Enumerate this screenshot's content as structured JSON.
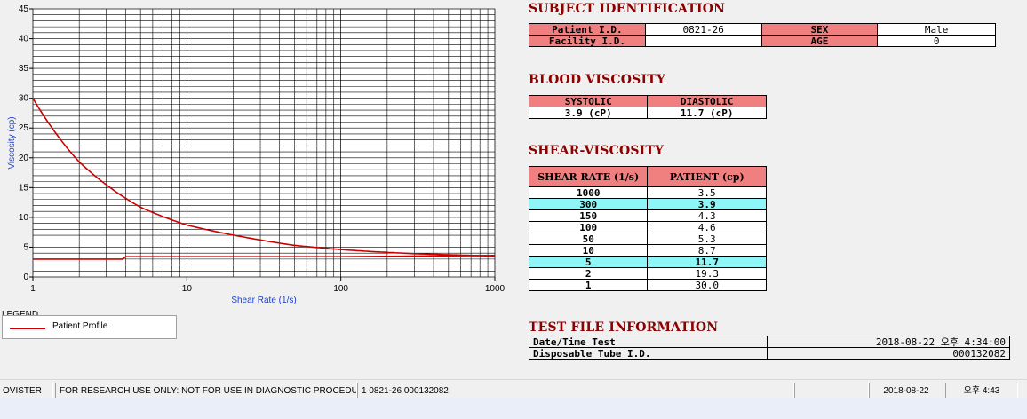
{
  "chart_data": {
    "type": "line",
    "xscale": "log",
    "xlim": [
      1,
      1000
    ],
    "ylim": [
      0,
      45
    ],
    "xticks": [
      "1",
      "10",
      "100",
      "1000"
    ],
    "yticks": [
      "0",
      "5",
      "10",
      "15",
      "20",
      "25",
      "30",
      "35",
      "40",
      "45"
    ],
    "xlabel": "Shear Rate (1/s)",
    "ylabel": "Viscosity (cp)",
    "grid": true,
    "series": [
      {
        "name": "Patient Profile",
        "color": "#cc0000",
        "x": [
          1,
          2,
          5,
          10,
          50,
          100,
          150,
          300,
          1000
        ],
        "y": [
          30.0,
          19.3,
          11.7,
          8.7,
          5.3,
          4.6,
          4.3,
          3.9,
          3.5
        ]
      },
      {
        "color": "#cc0000",
        "x": [
          1,
          3.8,
          4,
          10,
          100,
          1000
        ],
        "y": [
          3.0,
          3.0,
          3.4,
          3.4,
          3.4,
          3.6
        ]
      }
    ]
  },
  "legend": {
    "title": "LEGEND",
    "items": [
      {
        "label": "Patient Profile",
        "color": "#cc0000"
      }
    ]
  },
  "subject": {
    "title": "SUBJECT IDENTIFICATION",
    "patient_id_label": "Patient I.D.",
    "patient_id": "0821-26",
    "sex_label": "SEX",
    "sex": "Male",
    "facility_id_label": "Facility I.D.",
    "facility_id": "",
    "age_label": "AGE",
    "age": "0"
  },
  "blood_viscosity": {
    "title": "BLOOD VISCOSITY",
    "systolic_label": "SYSTOLIC",
    "systolic": "3.9 (cP)",
    "diastolic_label": "DIASTOLIC",
    "diastolic": "11.7 (cP)"
  },
  "shear_viscosity": {
    "title": "SHEAR-VISCOSITY",
    "col1": "SHEAR RATE (1/s)",
    "col2": "PATIENT (cp)",
    "rows": [
      {
        "rate": "1000",
        "value": "3.5"
      },
      {
        "rate": "300",
        "value": "3.9"
      },
      {
        "rate": "150",
        "value": "4.3"
      },
      {
        "rate": "100",
        "value": "4.6"
      },
      {
        "rate": "50",
        "value": "5.3"
      },
      {
        "rate": "10",
        "value": "8.7"
      },
      {
        "rate": "5",
        "value": "11.7"
      },
      {
        "rate": "2",
        "value": "19.3"
      },
      {
        "rate": "1",
        "value": "30.0"
      }
    ]
  },
  "test_file": {
    "title": "TEST FILE INFORMATION",
    "datetime_label": "Date/Time Test",
    "datetime": "2018-08-22  오후 4:34:00",
    "tube_label": "Disposable Tube I.D.",
    "tube": "000132082"
  },
  "status_bar": {
    "app": "OVISTER",
    "notice": "FOR RESEARCH USE ONLY: NOT FOR USE IN DIAGNOSTIC PROCEDURES",
    "record": "1  0821-26  000132082",
    "empty": "",
    "date": "2018-08-22",
    "time": "오후 4:43"
  }
}
